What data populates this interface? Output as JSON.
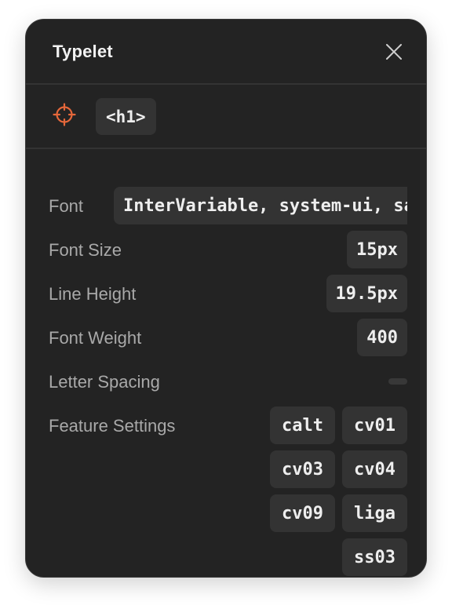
{
  "app": {
    "title": "Typelet",
    "close_icon": "close-icon",
    "accent_color": "#e5673a"
  },
  "selector": {
    "target_icon": "crosshair-icon",
    "element_tag": "<h1>"
  },
  "properties": {
    "font": {
      "label": "Font",
      "value": "InterVariable, system-ui, sans-serif"
    },
    "font_size": {
      "label": "Font Size",
      "value": "15px"
    },
    "line_height": {
      "label": "Line Height",
      "value": "19.5px"
    },
    "font_weight": {
      "label": "Font Weight",
      "value": "400"
    },
    "letter_spacing": {
      "label": "Letter Spacing",
      "value": ""
    },
    "feature_settings": {
      "label": "Feature Settings",
      "values": [
        "calt",
        "cv01",
        "cv03",
        "cv04",
        "cv09",
        "liga",
        "ss03"
      ]
    }
  }
}
